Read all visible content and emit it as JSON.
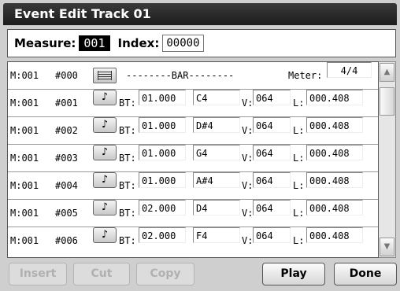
{
  "title": "Event Edit Track 01",
  "measure": {
    "label": "Measure:",
    "value": "001",
    "index_label": "Index:",
    "index_value": "00000"
  },
  "bar_row": {
    "m": "M:001",
    "num": "#000",
    "text": "--------BAR--------",
    "meter_label": "Meter:",
    "meter_value": "4/4"
  },
  "events": [
    {
      "m": "M:001",
      "num": "#001",
      "bt_label": "BT:",
      "bt": "01.000",
      "note": "C4",
      "v_label": "V:",
      "v": "064",
      "l_label": "L:",
      "l": "000.408"
    },
    {
      "m": "M:001",
      "num": "#002",
      "bt_label": "BT:",
      "bt": "01.000",
      "note": "D#4",
      "v_label": "V:",
      "v": "064",
      "l_label": "L:",
      "l": "000.408"
    },
    {
      "m": "M:001",
      "num": "#003",
      "bt_label": "BT:",
      "bt": "01.000",
      "note": "G4",
      "v_label": "V:",
      "v": "064",
      "l_label": "L:",
      "l": "000.408"
    },
    {
      "m": "M:001",
      "num": "#004",
      "bt_label": "BT:",
      "bt": "01.000",
      "note": "A#4",
      "v_label": "V:",
      "v": "064",
      "l_label": "L:",
      "l": "000.408"
    },
    {
      "m": "M:001",
      "num": "#005",
      "bt_label": "BT:",
      "bt": "02.000",
      "note": "D4",
      "v_label": "V:",
      "v": "064",
      "l_label": "L:",
      "l": "000.408"
    },
    {
      "m": "M:001",
      "num": "#006",
      "bt_label": "BT:",
      "bt": "02.000",
      "note": "F4",
      "v_label": "V:",
      "v": "064",
      "l_label": "L:",
      "l": "000.408"
    }
  ],
  "note_glyph": "♪",
  "scroll": {
    "up": "▲",
    "down": "▼"
  },
  "buttons": {
    "insert": "Insert",
    "cut": "Cut",
    "copy": "Copy",
    "play": "Play",
    "done": "Done"
  }
}
